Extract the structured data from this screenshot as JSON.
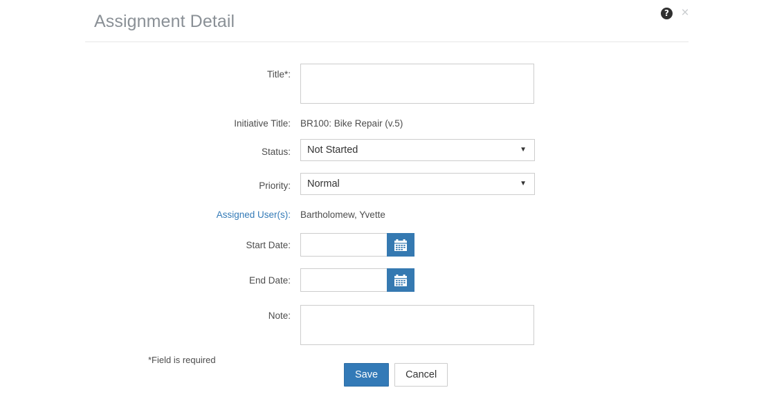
{
  "header": {
    "title": "Assignment Detail",
    "help_icon": "help-circle-icon",
    "help_glyph": "?",
    "close_icon": "close-icon",
    "close_glyph": "×"
  },
  "form": {
    "title_label": "Title*:",
    "title_value": "",
    "initiative_label": "Initiative Title:",
    "initiative_value": "BR100: Bike Repair (v.5)",
    "status_label": "Status:",
    "status_value": "Not Started",
    "status_caret": "▼",
    "priority_label": "Priority:",
    "priority_value": "Normal",
    "priority_caret": "▼",
    "assigned_label": "Assigned User(s):",
    "assigned_value": "Bartholomew, Yvette",
    "start_date_label": "Start Date:",
    "start_date_value": "",
    "end_date_label": "End Date:",
    "end_date_value": "",
    "note_label": "Note:",
    "note_value": "",
    "calendar_icon": "calendar-icon",
    "required_note": "*Field is required"
  },
  "footer": {
    "save_label": "Save",
    "cancel_label": "Cancel"
  },
  "colors": {
    "primary": "#337ab7",
    "calendar_button": "#3579b1",
    "link": "#337ab7",
    "title_text": "#8a9096",
    "border": "#cccccc"
  }
}
